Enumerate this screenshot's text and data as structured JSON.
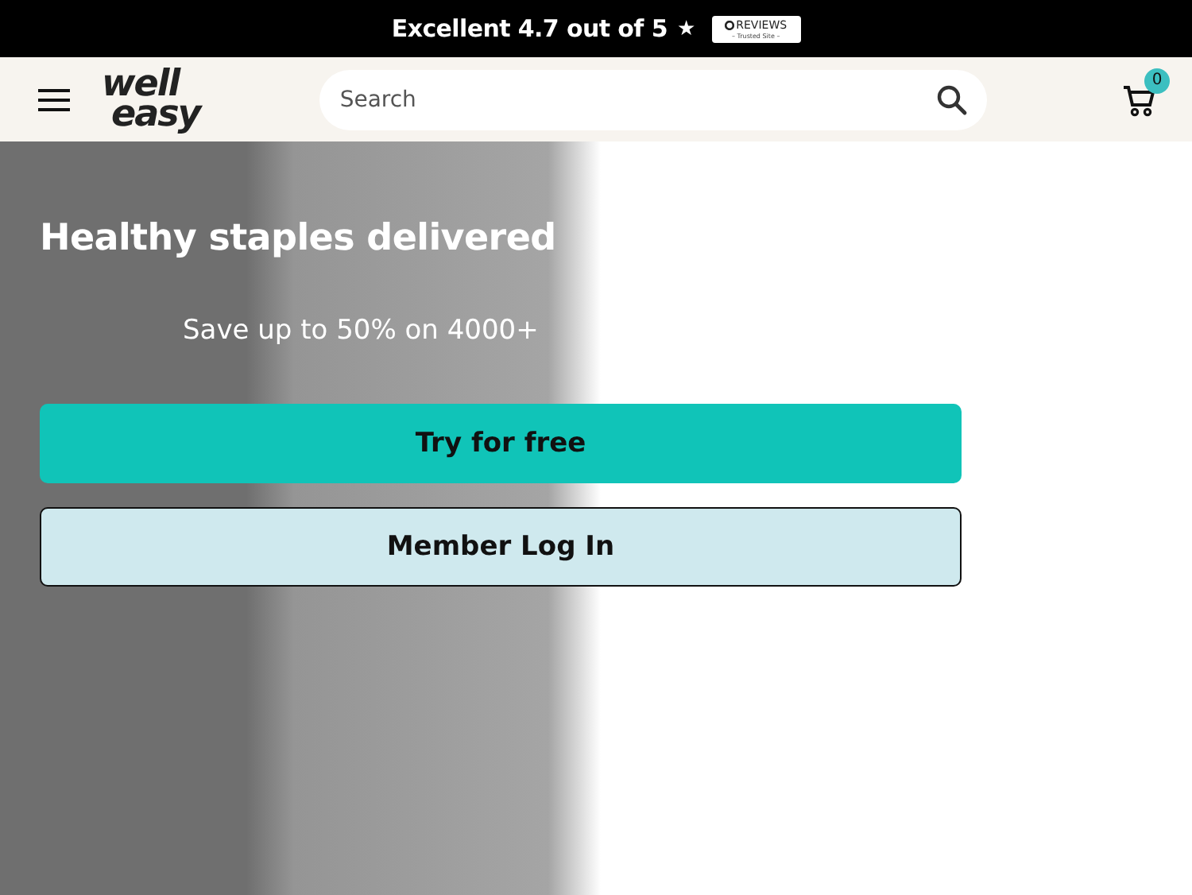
{
  "top_bar": {
    "rating_text": "Excellent 4.7 out of 5",
    "star": "★",
    "badge": {
      "name": "REVIEWS",
      "subtitle": "– Trusted Site –"
    }
  },
  "header": {
    "logo": [
      "well",
      "easy"
    ],
    "search": {
      "placeholder": "Search"
    },
    "cart_count": "0"
  },
  "hero": {
    "title": "Healthy staples delivered",
    "subtitle": "Save up to 50% on 4000+",
    "buttons": [
      {
        "label": "Try for free",
        "kind": "primary"
      },
      {
        "label": "Member Log In",
        "kind": "secondary"
      }
    ]
  }
}
